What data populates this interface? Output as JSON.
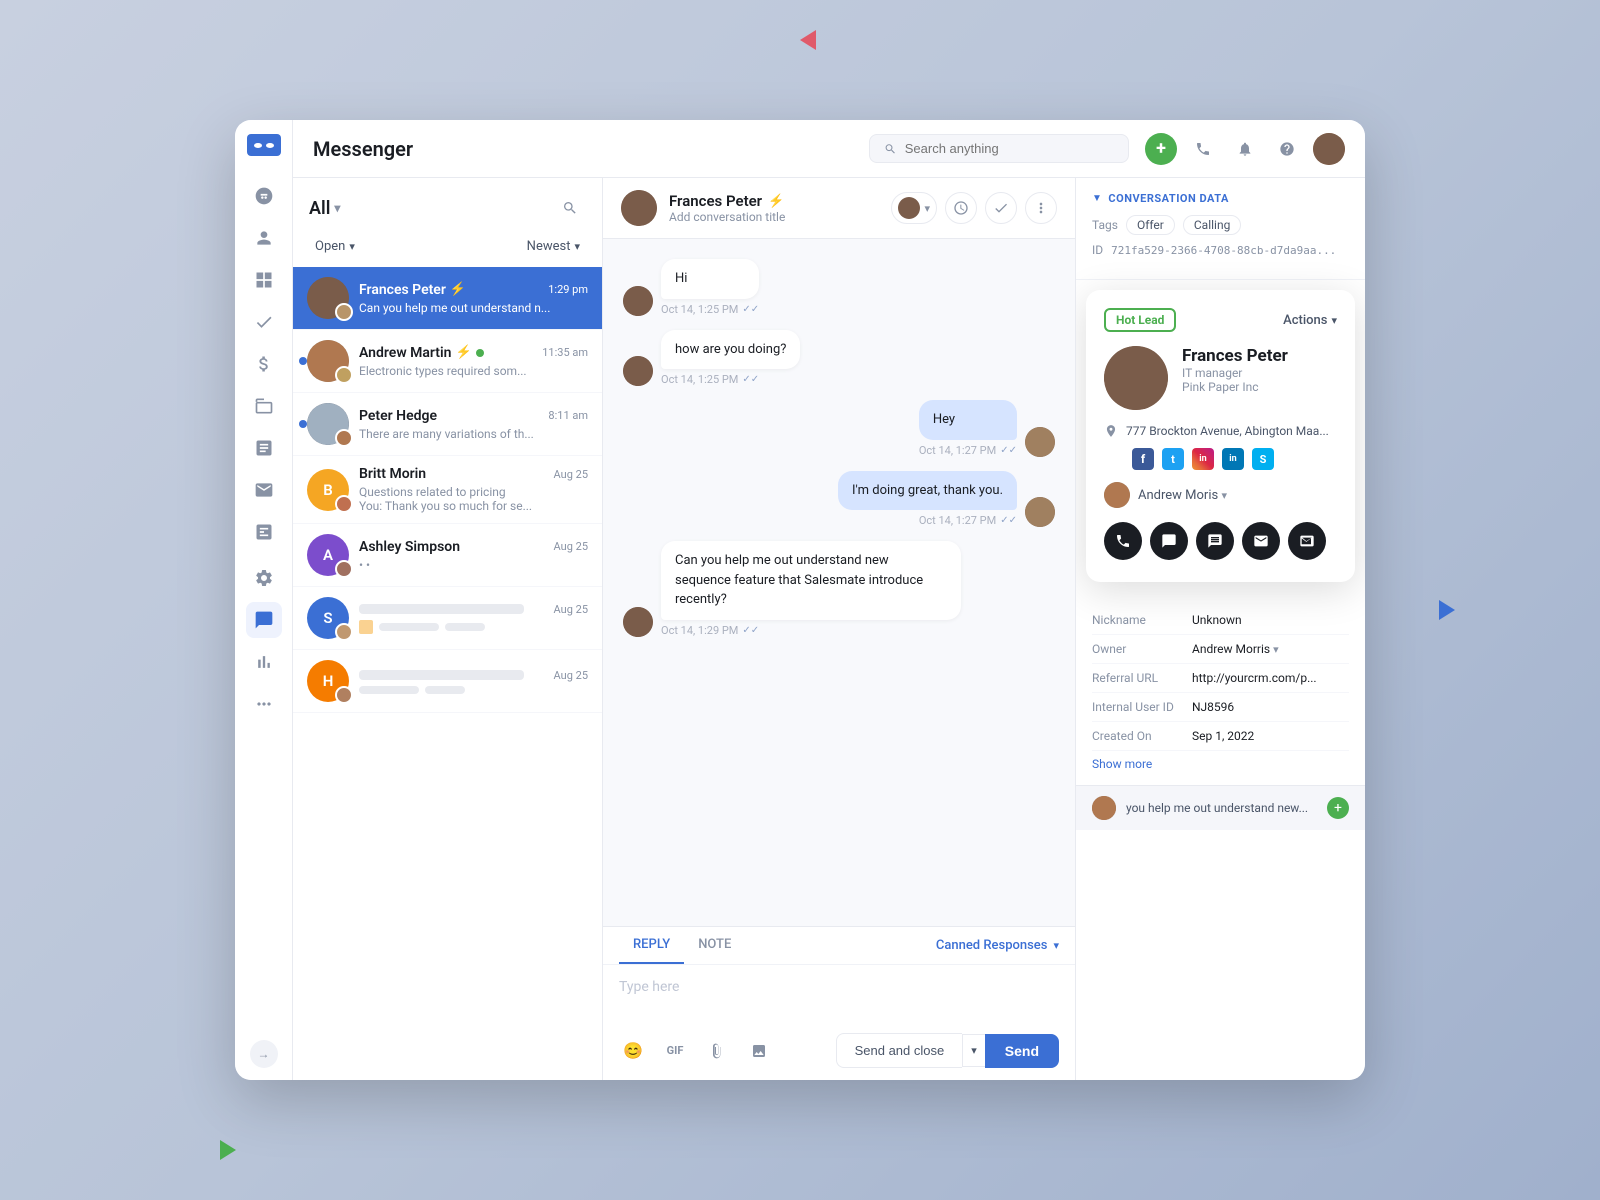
{
  "app": {
    "title": "Messenger",
    "search_placeholder": "Search anything"
  },
  "header": {
    "title": "Messenger",
    "search_placeholder": "Search anything",
    "add_btn": "+",
    "phone_icon": "📞",
    "bell_icon": "🔔",
    "help_icon": "?"
  },
  "sidebar": {
    "nav_items": [
      {
        "name": "conversations",
        "icon": "💬"
      },
      {
        "name": "contacts",
        "icon": "👤"
      },
      {
        "name": "grid",
        "icon": "⊞"
      },
      {
        "name": "check",
        "icon": "✓"
      },
      {
        "name": "dollar",
        "icon": "$"
      },
      {
        "name": "box",
        "icon": "□"
      },
      {
        "name": "report",
        "icon": "📋"
      },
      {
        "name": "mail",
        "icon": "✉"
      },
      {
        "name": "inbox",
        "icon": "📥"
      },
      {
        "name": "settings",
        "icon": "⚙"
      },
      {
        "name": "chat-active",
        "icon": "💬"
      },
      {
        "name": "chart",
        "icon": "📊"
      },
      {
        "name": "dots",
        "icon": "•••"
      }
    ]
  },
  "conversation_list": {
    "all_label": "All",
    "filter_open": "Open",
    "filter_newest": "Newest",
    "items": [
      {
        "id": 1,
        "name": "Frances Peter",
        "time": "1:29 pm",
        "preview": "Can you help me out understand n...",
        "active": true,
        "has_lightning": true,
        "unread": false
      },
      {
        "id": 2,
        "name": "Andrew Martin",
        "time": "11:35 am",
        "preview": "Electronic types required som...",
        "active": false,
        "has_lightning": true,
        "unread": true,
        "online": true
      },
      {
        "id": 3,
        "name": "Peter Hedge",
        "time": "8:11 am",
        "preview": "There are many variations of th...",
        "active": false,
        "has_lightning": false,
        "unread": true
      },
      {
        "id": 4,
        "name": "Britt Morin",
        "time": "Aug 25",
        "preview": "Questions related to pricing",
        "preview2": "You: Thank you so much for se...",
        "active": false,
        "avatar_letter": "B",
        "avatar_color": "yellow"
      },
      {
        "id": 5,
        "name": "Ashley Simpson",
        "time": "Aug 25",
        "preview": "• •",
        "active": false,
        "avatar_letter": "A",
        "avatar_color": "purple"
      },
      {
        "id": 6,
        "name": "",
        "time": "Aug 25",
        "preview": "",
        "active": false,
        "avatar_letter": "S",
        "avatar_color": "blue"
      },
      {
        "id": 7,
        "name": "",
        "time": "Aug 25",
        "preview": "",
        "active": false,
        "avatar_letter": "H",
        "avatar_color": "orange"
      }
    ]
  },
  "chat": {
    "contact_name": "Frances Peter",
    "contact_subtitle": "Add conversation title",
    "messages": [
      {
        "id": 1,
        "type": "incoming",
        "text": "Hi",
        "time": "Oct 14, 1:25 PM",
        "avatar": true
      },
      {
        "id": 2,
        "type": "incoming",
        "text": "how are you doing?",
        "time": "Oct 14, 1:25 PM",
        "avatar": true
      },
      {
        "id": 3,
        "type": "outgoing",
        "text": "Hey",
        "time": "Oct 14, 1:27 PM",
        "avatar": true
      },
      {
        "id": 4,
        "type": "outgoing",
        "text": "I'm doing great, thank you.",
        "time": "Oct 14, 1:27 PM",
        "avatar": true
      },
      {
        "id": 5,
        "type": "incoming",
        "text": "Can you help me out understand new sequence feature that Salesmate introduce recently?",
        "time": "Oct 14, 1:29 PM",
        "avatar": true
      }
    ],
    "reply_tab_active": "REPLY",
    "reply_tab_note": "NOTE",
    "canned_responses_label": "Canned Responses",
    "type_placeholder": "Type here",
    "send_close_label": "Send and close",
    "send_label": "Send"
  },
  "right_panel": {
    "conv_data_title": "CONVERSATION DATA",
    "tags": [
      "Offer",
      "Calling"
    ],
    "conv_id": "721fa529-2366-4708-88cb-d7da9aa...",
    "contact_card": {
      "hot_lead_label": "Hot Lead",
      "actions_label": "Actions",
      "name": "Frances Peter",
      "role": "IT manager",
      "company": "Pink Paper Inc",
      "address": "777 Brockton Avenue, Abington Maa...",
      "owner_name": "Andrew Moris",
      "social": [
        "f",
        "t",
        "in",
        "li",
        "sk"
      ]
    },
    "details": {
      "nickname_label": "Nickname",
      "nickname_value": "Unknown",
      "owner_label": "Owner",
      "owner_value": "Andrew Morris",
      "referral_label": "Referral URL",
      "referral_value": "http://yourcrm.com/p...",
      "internal_id_label": "Internal User ID",
      "internal_id_value": "NJ8596",
      "created_label": "Created On",
      "created_value": "Sep 1, 2022",
      "show_more_label": "Show more"
    },
    "suggestion_text": "you help me out understand new...",
    "suggestion_add_label": "+"
  }
}
